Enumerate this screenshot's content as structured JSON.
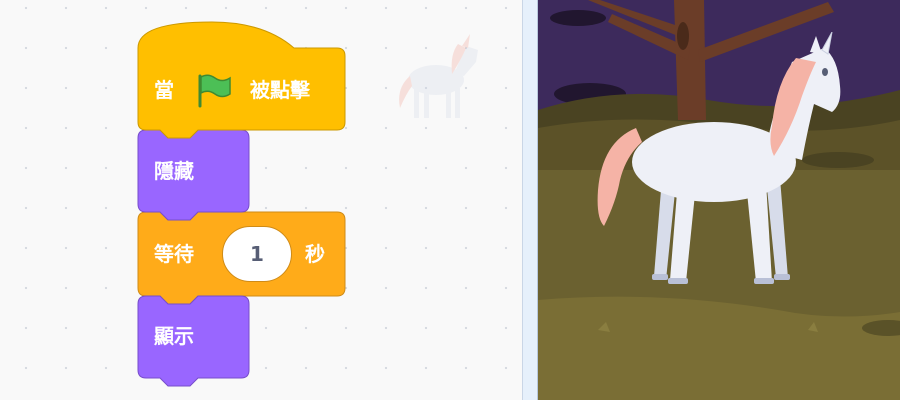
{
  "code_area": {
    "script": {
      "when_flag_clicked": {
        "prefix": "當",
        "suffix": "被點擊",
        "icon": "green-flag-icon",
        "color": "#ffbf00"
      },
      "hide": {
        "label": "隱藏",
        "color": "#9966ff"
      },
      "wait": {
        "prefix": "等待",
        "value": "1",
        "suffix": "秒",
        "color": "#ffab19"
      },
      "show": {
        "label": "顯示",
        "color": "#9966ff"
      }
    },
    "ghost_sprite": {
      "icon": "unicorn-sprite-icon"
    }
  },
  "stage": {
    "backdrop": "night forest with tree",
    "sprite": {
      "icon": "unicorn-sprite-icon"
    },
    "colors": {
      "sky": "#3d2a5c",
      "ground": "#7a6e35",
      "unicorn_mane": "#f5b3a6",
      "unicorn_body": "#eef0f7"
    }
  }
}
